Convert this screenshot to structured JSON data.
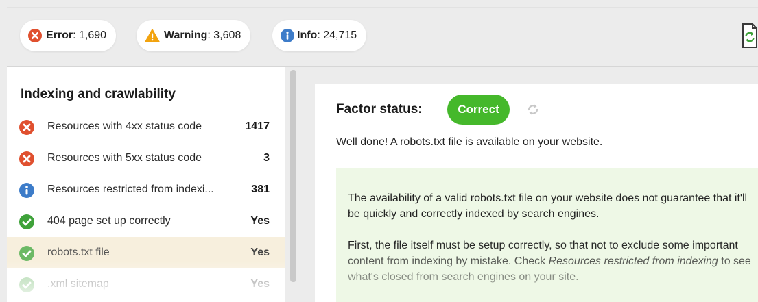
{
  "summary": {
    "error": {
      "label": "Error",
      "value": ": 1,690",
      "icon": "error-icon"
    },
    "warning": {
      "label": "Warning",
      "value": ": 3,608",
      "icon": "warning-icon"
    },
    "info": {
      "label": "Info",
      "value": ": 24,715",
      "icon": "info-icon"
    }
  },
  "colors": {
    "error": "#e0502f",
    "warning": "#f2a30f",
    "info": "#3d7cc9",
    "ok": "#3fa23a",
    "correct_badge": "#45b82b",
    "selected_row": "#f7efdd",
    "info_box": "#eef8e6"
  },
  "sidebar": {
    "title": "Indexing and crawlability",
    "items": [
      {
        "label": "Resources with 4xx status code",
        "value": "1417",
        "icon": "error-icon"
      },
      {
        "label": "Resources with 5xx status code",
        "value": "3",
        "icon": "error-icon"
      },
      {
        "label": "Resources restricted from indexi...",
        "value": "381",
        "icon": "info-icon"
      },
      {
        "label": "404 page set up correctly",
        "value": "Yes",
        "icon": "check-icon"
      },
      {
        "label": "robots.txt file",
        "value": "Yes",
        "icon": "check-icon"
      },
      {
        "label": ".xml sitemap",
        "value": "Yes",
        "icon": "check-icon"
      }
    ]
  },
  "detail": {
    "factor_label": "Factor status:",
    "status_badge": "Correct",
    "message": "Well done! A robots.txt file is available on your website.",
    "paragraph1": "The availability of a valid robots.txt file on your website does not guarantee that it'll be quickly and correctly indexed by search engines.",
    "paragraph2_before": "First, the file itself must be setup correctly, so that not to exclude some important content from indexing by mistake. Check ",
    "paragraph2_link": "Resources restricted from indexing",
    "paragraph2_after": " to see what's closed from search engines on your site."
  }
}
